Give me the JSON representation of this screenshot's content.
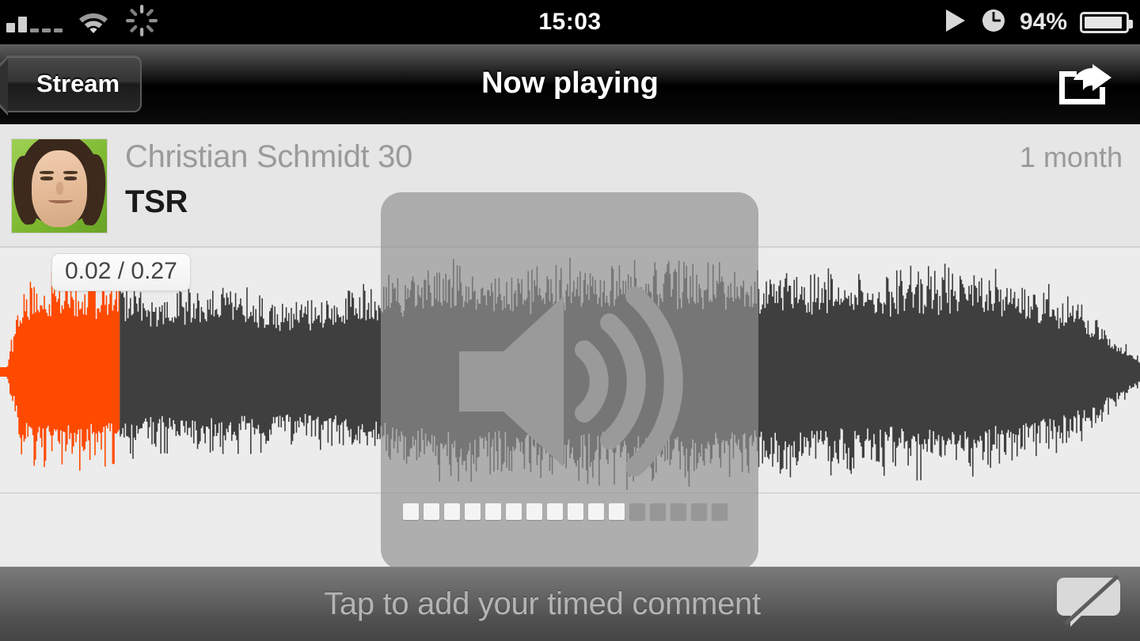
{
  "status_bar": {
    "time": "15:03",
    "battery_percent": "94%",
    "icons": [
      "signal-bars-icon",
      "wifi-icon",
      "activity-spinner-icon",
      "play-icon",
      "alarm-clock-icon",
      "battery-icon"
    ],
    "signal_bars_filled": 2,
    "signal_bars_total": 5,
    "battery_level": 94
  },
  "nav_bar": {
    "back_label": "Stream",
    "title": "Now playing",
    "share_icon": "share-icon"
  },
  "track": {
    "username": "Christian Schmidt 30",
    "title": "TSR",
    "age": "1 month",
    "avatar_icon": "user-avatar"
  },
  "player": {
    "time_display": "0.02 / 0.27",
    "elapsed": "0.02",
    "duration": "0.27",
    "progress_percent": 10.5,
    "waveform_progress_color": "#FF4A00",
    "waveform_color": "#3f3f3f",
    "waveform_bg": "#ececec"
  },
  "volume_hud": {
    "icon": "speaker-volume-icon",
    "segments_total": 16,
    "segments_filled": 11,
    "level_percent": 69
  },
  "bottom_bar": {
    "comment_placeholder": "Tap to add your timed comment",
    "comment_icon": "comment-bubble-icon"
  },
  "colors": {
    "accent_orange": "#FF4A00",
    "nav_black": "#000000",
    "panel_gray": "#E6E6E6",
    "wave_dark": "#3F3F3F"
  }
}
